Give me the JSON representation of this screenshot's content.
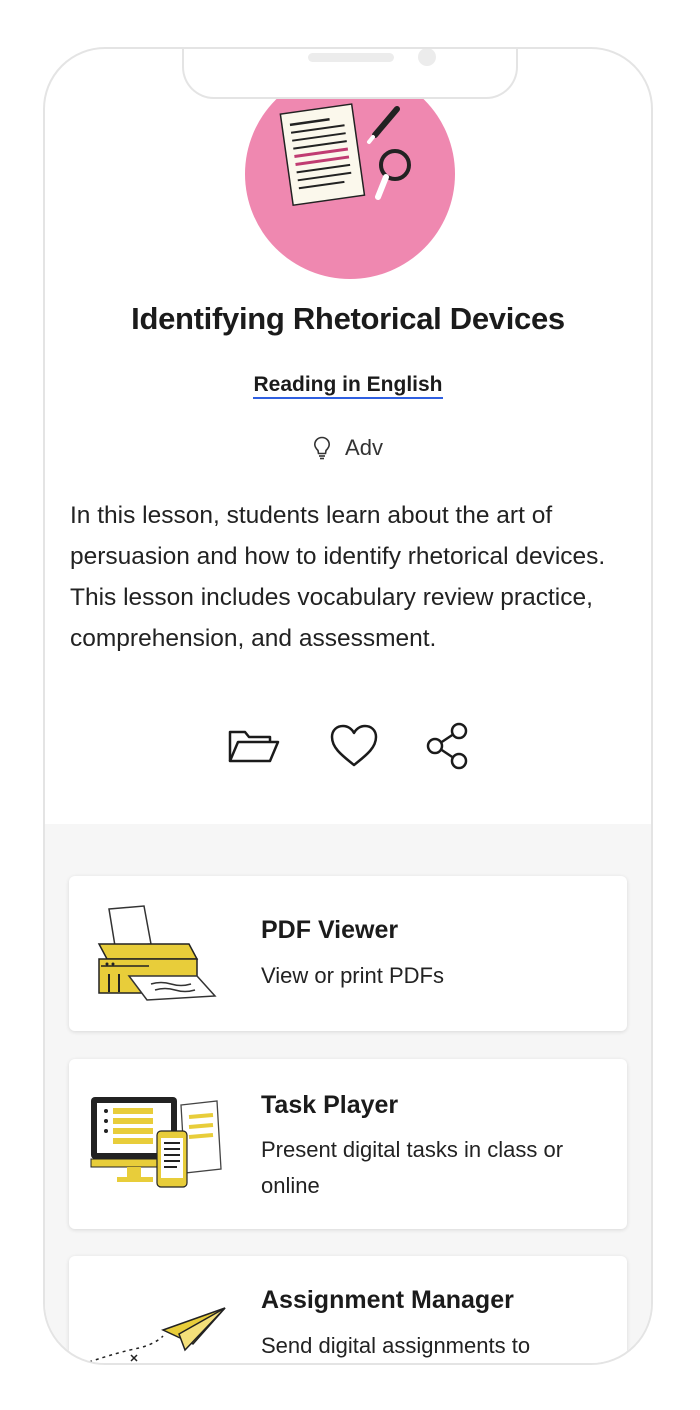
{
  "lesson": {
    "title": "Identifying Rhetorical Devices",
    "subject": "Reading in English",
    "level": "Adv",
    "description": "In this lesson, students learn about the art of persuasion and how to identify rhetorical devices. This lesson includes vocabulary review practice, comprehension, and assessment.",
    "hero_icon": "document-with-pencil-and-magnifier",
    "hero_color": "#ef88b0"
  },
  "actions": [
    {
      "name": "folder-icon"
    },
    {
      "name": "heart-icon"
    },
    {
      "name": "share-icon"
    }
  ],
  "tools": [
    {
      "title": "PDF Viewer",
      "description": "View or print PDFs",
      "icon": "printer-illustration"
    },
    {
      "title": "Task Player",
      "description": "Present digital tasks in class or online",
      "icon": "devices-illustration"
    },
    {
      "title": "Assignment Manager",
      "description": "Send digital assignments to",
      "icon": "paper-plane-illustration"
    }
  ],
  "colors": {
    "accent_yellow": "#e8cd3a",
    "link_underline": "#2f5fe0"
  }
}
